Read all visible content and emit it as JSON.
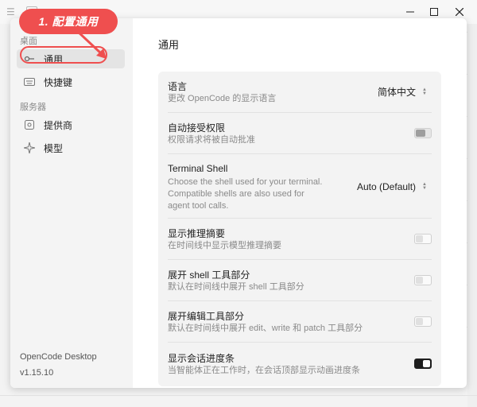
{
  "window": {
    "minimize_icon": "minimize-icon",
    "maximize_icon": "maximize-icon",
    "close_icon": "close-icon"
  },
  "sidebar": {
    "section_desktop": "桌面",
    "section_server": "服务器",
    "items": [
      {
        "label": "通用",
        "icon": "general-settings-icon",
        "active": true
      },
      {
        "label": "快捷键",
        "icon": "keyboard-icon",
        "active": false
      },
      {
        "label": "提供商",
        "icon": "provider-icon",
        "active": false
      },
      {
        "label": "模型",
        "icon": "sparkle-icon",
        "active": false
      }
    ],
    "app_name": "OpenCode Desktop",
    "version": "v1.15.10"
  },
  "main": {
    "title": "通用",
    "settings": [
      {
        "title": "语言",
        "desc": "更改 OpenCode 的显示语言",
        "control": "select",
        "value": "简体中文"
      },
      {
        "title": "自动接受权限",
        "desc": "权限请求将被自动批准",
        "control": "toggle",
        "state": "disabled"
      },
      {
        "title": "Terminal Shell",
        "desc": "Choose the shell used for your terminal. Compatible shells are also used for agent tool calls.",
        "control": "select",
        "value": "Auto (Default)"
      },
      {
        "title": "显示推理摘要",
        "desc": "在时间线中显示模型推理摘要",
        "control": "toggle",
        "state": "off"
      },
      {
        "title": "展开 shell 工具部分",
        "desc": "默认在时间线中展开 shell 工具部分",
        "control": "toggle",
        "state": "off"
      },
      {
        "title": "展开编辑工具部分",
        "desc": "默认在时间线中展开 edit、write 和 patch 工具部分",
        "control": "toggle",
        "state": "off"
      },
      {
        "title": "显示会话进度条",
        "desc": "当智能体正在工作时，在会话顶部显示动画进度条",
        "control": "toggle",
        "state": "on"
      }
    ]
  },
  "annotation": {
    "label": "1. 配置通用",
    "color": "#ef4f4f"
  },
  "colors": {
    "annotation_red": "#ef4f4f",
    "toggle_on": "#1e1e1e",
    "sidebar_bg": "#f4f4f4",
    "card_bg": "#f3f3f3"
  }
}
